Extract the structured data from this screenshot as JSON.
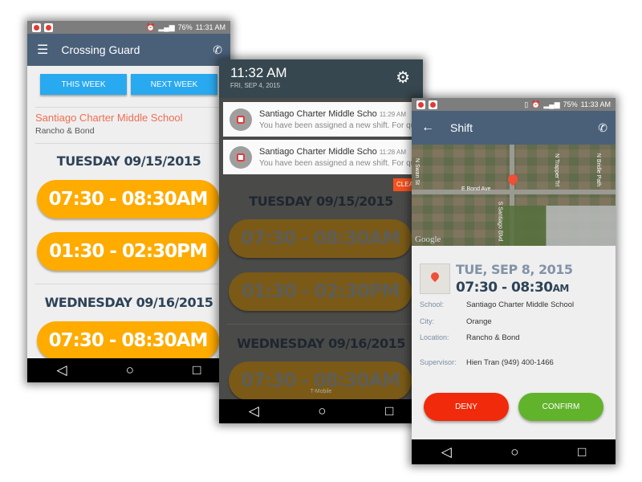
{
  "phone1": {
    "status": {
      "battery": "76%",
      "time": "11:31 AM"
    },
    "title": "Crossing Guard",
    "tabs": [
      "THIS WEEK",
      "NEXT WEEK"
    ],
    "school": "Santiago Charter Middle School",
    "address": "Rancho & Bond",
    "days": [
      {
        "label": "TUESDAY 09/15/2015",
        "shifts": [
          "07:30 - 08:30AM",
          "01:30 - 02:30PM"
        ]
      },
      {
        "label": "WEDNESDAY 09/16/2015",
        "shifts": [
          "07:30 - 08:30AM"
        ]
      }
    ],
    "accent": "#ffab00"
  },
  "phone2": {
    "time": "11:32 AM",
    "date": "FRI, SEP 4, 2015",
    "notifications": [
      {
        "title": "Santiago Charter Middle Scho",
        "time": "11:29 AM",
        "text": "You have been assigned a new shift. For qu"
      },
      {
        "title": "Santiago Charter Middle Scho",
        "time": "11:28 AM",
        "text": "You have been assigned a new shift. For qu"
      }
    ],
    "clear": "CLEA",
    "carrier": "T-Mobile",
    "days": [
      {
        "label": "TUESDAY 09/15/2015",
        "shifts": [
          "07:30 - 08:30AM",
          "01:30 - 02:30PM"
        ]
      },
      {
        "label": "WEDNESDAY 09/16/2015",
        "shifts": [
          "07:30 - 08:30AM"
        ]
      }
    ]
  },
  "phone3": {
    "status": {
      "battery": "75%",
      "time": "11:33 AM"
    },
    "title": "Shift",
    "map": {
      "streets": [
        "E Bond Ave",
        "S Santiago Blvd",
        "N Swan St",
        "N Trapper Trl",
        "N Bridle Path"
      ],
      "logo": "Google"
    },
    "date": "TUE, SEP 8, 2015",
    "time_range": "07:30 - 08:30",
    "time_suffix": "AM",
    "details": [
      {
        "label": "School:",
        "value": "Santiago Charter Middle School"
      },
      {
        "label": "City:",
        "value": "Orange"
      },
      {
        "label": "Location:",
        "value": "Rancho & Bond"
      },
      {
        "label": "Supervisor:",
        "value": "Hien Tran (949) 400-1466"
      }
    ],
    "deny": "DENY",
    "confirm": "CONFIRM",
    "colors": {
      "deny": "#f02a0a",
      "confirm": "#62b32c",
      "appbar": "#4a6079"
    }
  }
}
